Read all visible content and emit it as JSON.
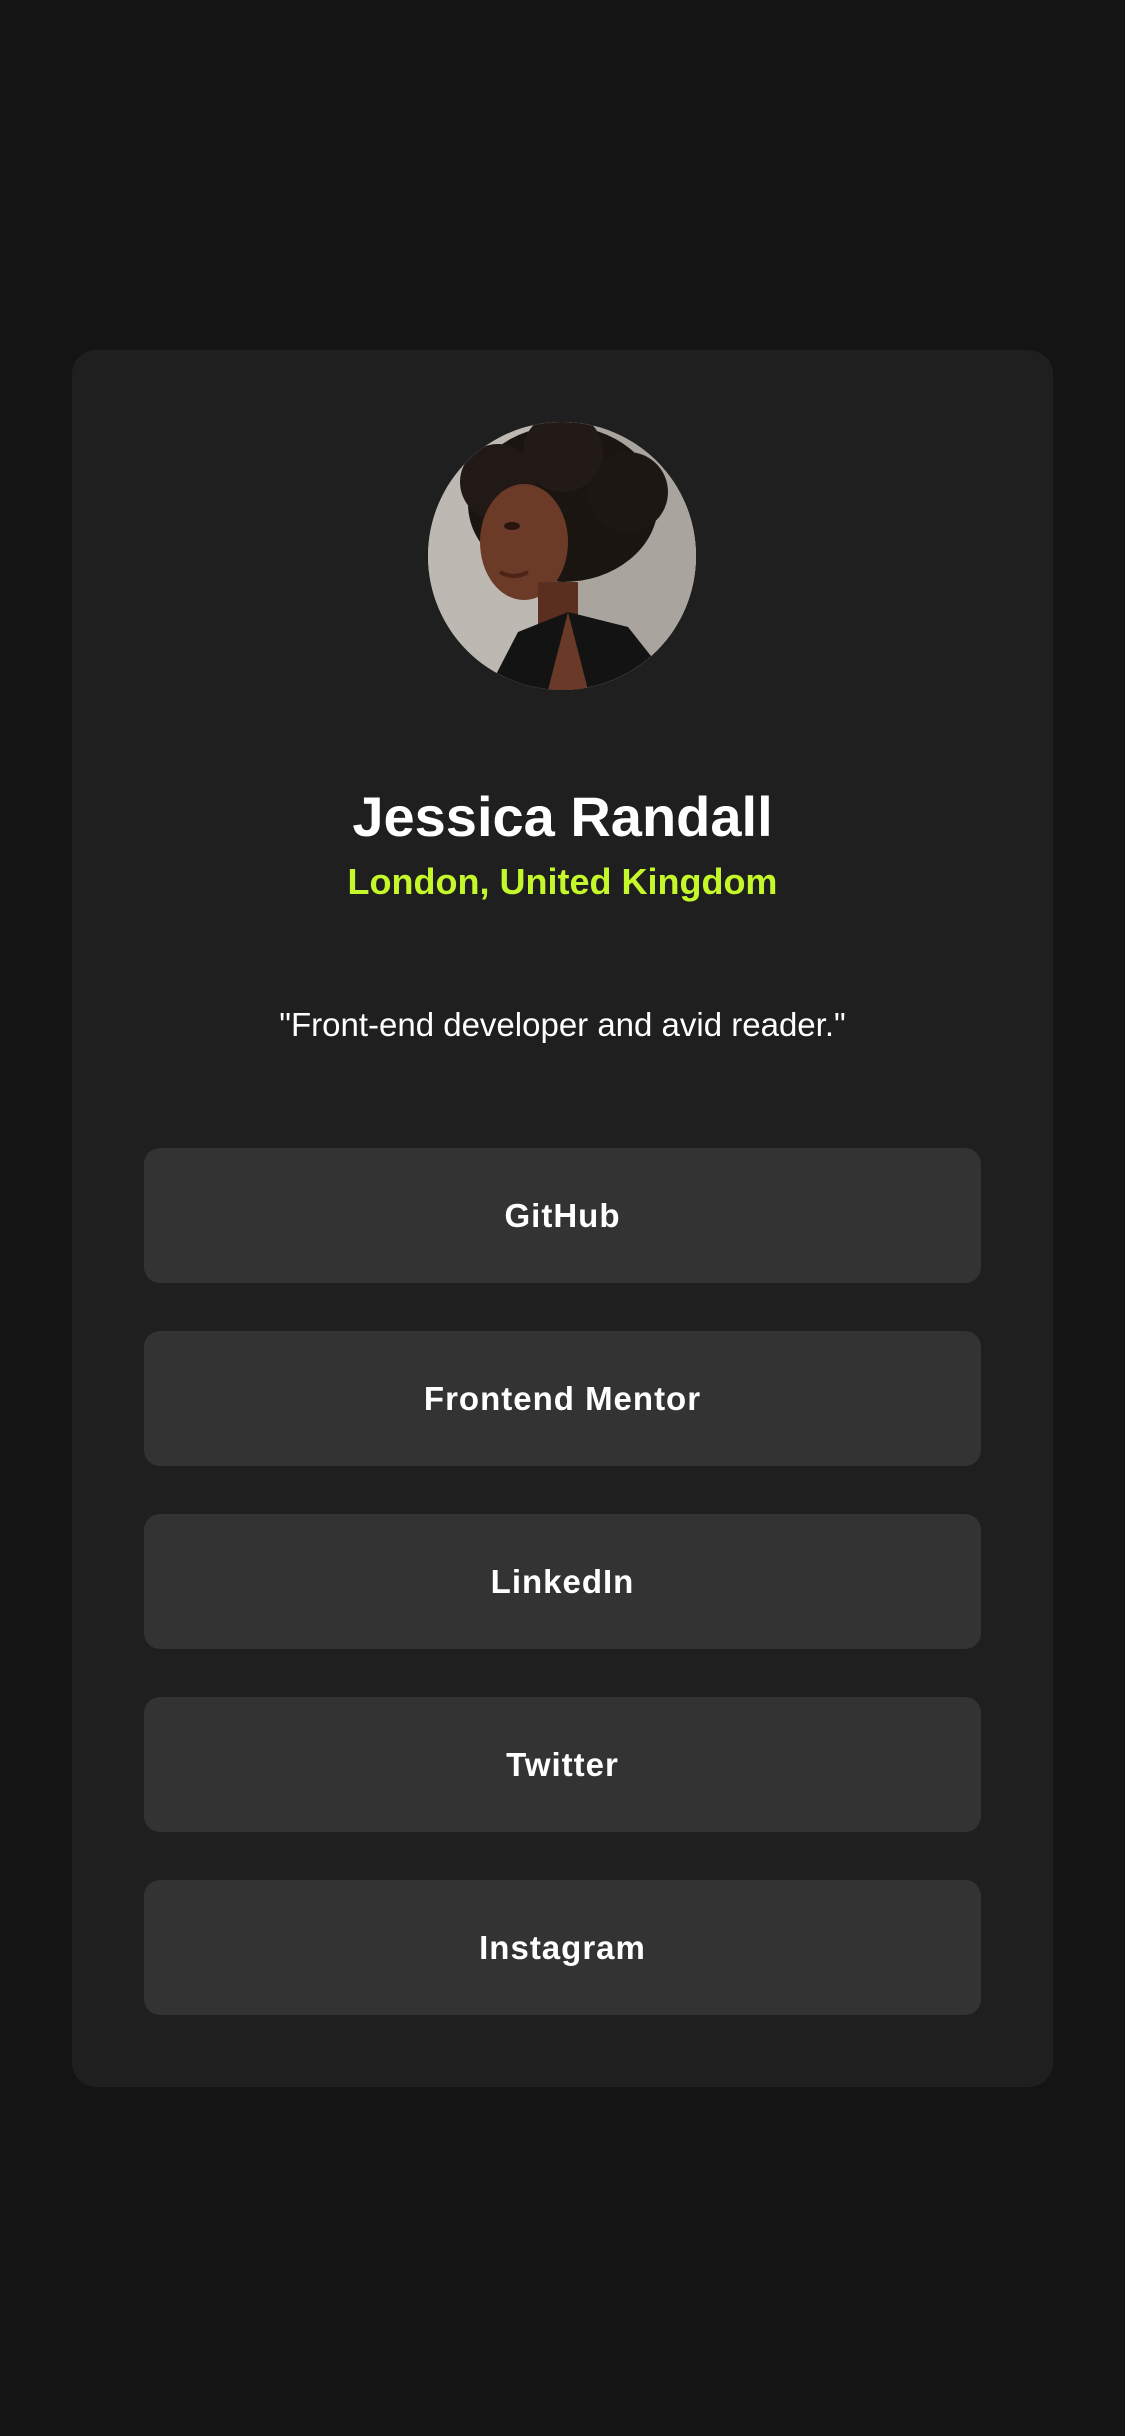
{
  "profile": {
    "avatar_icon": "profile-photo",
    "name": "Jessica Randall",
    "location": "London, United Kingdom",
    "bio": "\"Front-end developer and avid reader.\""
  },
  "links": [
    {
      "label": "GitHub"
    },
    {
      "label": "Frontend Mentor"
    },
    {
      "label": "LinkedIn"
    },
    {
      "label": "Twitter"
    },
    {
      "label": "Instagram"
    }
  ],
  "colors": {
    "page_background": "#141414",
    "card_background": "#1f1f1f",
    "button_background": "#333333",
    "accent": "#c4f82a",
    "text": "#ffffff"
  }
}
